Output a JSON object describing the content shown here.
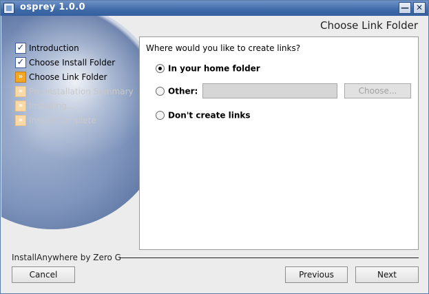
{
  "window": {
    "title": "osprey 1.0.0",
    "minimize_glyph": "—",
    "close_glyph": "✕"
  },
  "header": {
    "title": "Choose Link Folder"
  },
  "steps": [
    {
      "label": "Introduction",
      "icon": "checkbox-checked-icon",
      "state": "done"
    },
    {
      "label": "Choose Install Folder",
      "icon": "checkbox-checked-icon",
      "state": "done"
    },
    {
      "label": "Choose Link Folder",
      "icon": "arrow-right-icon",
      "state": "current"
    },
    {
      "label": "Pre-Installation Summary",
      "icon": "arrow-right-icon",
      "state": "disabled"
    },
    {
      "label": "Installing...",
      "icon": "arrow-right-icon",
      "state": "disabled"
    },
    {
      "label": "Install Complete",
      "icon": "arrow-right-icon",
      "state": "disabled"
    }
  ],
  "content": {
    "question": "Where would you like to create links?",
    "options": [
      {
        "label": "In your home folder",
        "checked": true
      },
      {
        "label": "Other:",
        "checked": false
      },
      {
        "label": "Don't create links",
        "checked": false
      }
    ],
    "other_path_value": "",
    "choose_button": "Choose..."
  },
  "footer": {
    "vendor": "InstallAnywhere by Zero G",
    "cancel": "Cancel",
    "previous": "Previous",
    "next": "Next"
  }
}
